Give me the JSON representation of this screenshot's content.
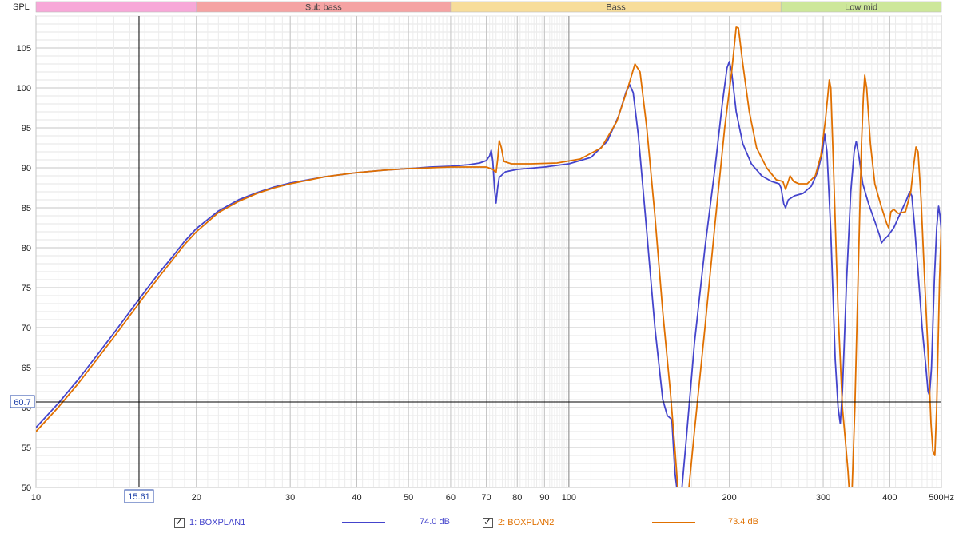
{
  "chart_data": {
    "type": "line",
    "y_axis_label": "SPL",
    "x_unit": "Hz",
    "xscale": "log",
    "xlim": [
      10,
      500
    ],
    "ylim": [
      50,
      109
    ],
    "y_ticks": [
      50,
      55,
      60,
      65,
      70,
      75,
      80,
      85,
      90,
      95,
      100,
      105
    ],
    "y_tick_labels": [
      "50",
      "55",
      "60",
      "65",
      "70",
      "75",
      "80",
      "85",
      "90",
      "95",
      "100",
      "105"
    ],
    "x_ticks": [
      10,
      20,
      30,
      40,
      50,
      60,
      70,
      80,
      90,
      100,
      200,
      300,
      400,
      500
    ],
    "x_tick_labels": [
      "10",
      "20",
      "30",
      "40",
      "50",
      "60",
      "70",
      "80",
      "90",
      "100",
      "200",
      "300",
      "400",
      "500Hz"
    ],
    "bands": [
      {
        "label": "",
        "from": 10,
        "to": 20,
        "color": "#f7a8d8"
      },
      {
        "label": "Sub bass",
        "from": 20,
        "to": 60,
        "color": "#f5a3a3"
      },
      {
        "label": "Bass",
        "from": 60,
        "to": 250,
        "color": "#f7dd9a"
      },
      {
        "label": "Low mid",
        "from": 250,
        "to": 500,
        "color": "#cde79a"
      }
    ],
    "cursor": {
      "x": 15.61,
      "y": 60.7,
      "x_label": "15.61",
      "y_label": "60.7"
    },
    "series": [
      {
        "name": "1: BOXPLAN1",
        "color": "#4444cc",
        "readout": "74.0 dB",
        "points": [
          [
            10,
            57.5
          ],
          [
            11,
            60.5
          ],
          [
            12,
            63.5
          ],
          [
            13,
            66.5
          ],
          [
            14,
            69.3
          ],
          [
            15,
            72.0
          ],
          [
            16,
            74.5
          ],
          [
            17,
            76.8
          ],
          [
            18,
            78.8
          ],
          [
            19,
            80.8
          ],
          [
            20,
            82.4
          ],
          [
            22,
            84.6
          ],
          [
            24,
            86.0
          ],
          [
            26,
            86.9
          ],
          [
            28,
            87.6
          ],
          [
            30,
            88.1
          ],
          [
            35,
            88.9
          ],
          [
            40,
            89.4
          ],
          [
            45,
            89.7
          ],
          [
            50,
            89.9
          ],
          [
            55,
            90.1
          ],
          [
            60,
            90.2
          ],
          [
            65,
            90.4
          ],
          [
            68,
            90.6
          ],
          [
            70,
            90.9
          ],
          [
            71,
            91.5
          ],
          [
            71.5,
            92.2
          ],
          [
            72,
            90.8
          ],
          [
            72.5,
            87.5
          ],
          [
            73,
            85.6
          ],
          [
            73.5,
            87.5
          ],
          [
            74,
            88.8
          ],
          [
            76,
            89.5
          ],
          [
            80,
            89.8
          ],
          [
            90,
            90.1
          ],
          [
            100,
            90.5
          ],
          [
            110,
            91.3
          ],
          [
            118,
            93.3
          ],
          [
            124,
            96.5
          ],
          [
            128,
            99.5
          ],
          [
            130,
            100.4
          ],
          [
            132,
            99.4
          ],
          [
            135,
            94.0
          ],
          [
            140,
            82.0
          ],
          [
            145,
            70.0
          ],
          [
            150,
            61.0
          ],
          [
            153,
            59.0
          ],
          [
            156,
            58.5
          ],
          [
            158,
            52.0
          ],
          [
            160,
            49.0
          ],
          [
            163,
            50.0
          ],
          [
            166,
            56.0
          ],
          [
            172,
            68.0
          ],
          [
            180,
            80.0
          ],
          [
            188,
            90.0
          ],
          [
            194,
            98.0
          ],
          [
            198,
            102.5
          ],
          [
            200,
            103.3
          ],
          [
            202,
            102.0
          ],
          [
            206,
            97.0
          ],
          [
            212,
            93.0
          ],
          [
            220,
            90.5
          ],
          [
            230,
            89.0
          ],
          [
            240,
            88.3
          ],
          [
            248,
            88.0
          ],
          [
            250,
            87.5
          ],
          [
            253,
            85.5
          ],
          [
            255,
            85.0
          ],
          [
            258,
            86.0
          ],
          [
            265,
            86.5
          ],
          [
            275,
            86.8
          ],
          [
            285,
            87.7
          ],
          [
            293,
            89.5
          ],
          [
            299,
            92.0
          ],
          [
            302,
            94.2
          ],
          [
            305,
            92.0
          ],
          [
            310,
            82.0
          ],
          [
            316,
            66.0
          ],
          [
            320,
            60.0
          ],
          [
            323,
            58.0
          ],
          [
            326,
            62.0
          ],
          [
            332,
            76.0
          ],
          [
            338,
            87.0
          ],
          [
            343,
            92.0
          ],
          [
            346,
            93.3
          ],
          [
            350,
            91.5
          ],
          [
            356,
            88.0
          ],
          [
            365,
            85.5
          ],
          [
            375,
            83.3
          ],
          [
            383,
            81.5
          ],
          [
            386,
            80.6
          ],
          [
            390,
            81.0
          ],
          [
            397,
            81.5
          ],
          [
            407,
            82.5
          ],
          [
            420,
            84.5
          ],
          [
            430,
            86.0
          ],
          [
            436,
            87.0
          ],
          [
            440,
            86.5
          ],
          [
            445,
            83.0
          ],
          [
            452,
            77.0
          ],
          [
            460,
            70.0
          ],
          [
            467,
            65.5
          ],
          [
            472,
            62.0
          ],
          [
            475,
            61.5
          ],
          [
            479,
            65.0
          ],
          [
            485,
            76.0
          ],
          [
            490,
            82.5
          ],
          [
            494,
            85.2
          ],
          [
            497,
            84.0
          ],
          [
            500,
            82.0
          ],
          [
            506,
            80.0
          ],
          [
            512,
            79.6
          ]
        ]
      },
      {
        "name": "2: BOXPLAN2",
        "color": "#e07000",
        "readout": "73.4 dB",
        "points": [
          [
            10,
            57.0
          ],
          [
            11,
            60.0
          ],
          [
            12,
            63.0
          ],
          [
            13,
            66.0
          ],
          [
            14,
            68.8
          ],
          [
            15,
            71.5
          ],
          [
            16,
            74.0
          ],
          [
            17,
            76.3
          ],
          [
            18,
            78.4
          ],
          [
            19,
            80.4
          ],
          [
            20,
            82.0
          ],
          [
            22,
            84.4
          ],
          [
            24,
            85.8
          ],
          [
            26,
            86.8
          ],
          [
            28,
            87.5
          ],
          [
            30,
            88.0
          ],
          [
            35,
            88.9
          ],
          [
            40,
            89.4
          ],
          [
            45,
            89.7
          ],
          [
            50,
            89.9
          ],
          [
            55,
            90.0
          ],
          [
            60,
            90.1
          ],
          [
            65,
            90.1
          ],
          [
            70,
            90.1
          ],
          [
            72,
            89.8
          ],
          [
            73,
            89.4
          ],
          [
            73.5,
            91.0
          ],
          [
            74,
            93.4
          ],
          [
            74.7,
            92.5
          ],
          [
            75.5,
            90.8
          ],
          [
            78,
            90.5
          ],
          [
            85,
            90.5
          ],
          [
            95,
            90.6
          ],
          [
            105,
            91.1
          ],
          [
            115,
            92.5
          ],
          [
            123,
            95.8
          ],
          [
            129,
            100.0
          ],
          [
            133,
            103.0
          ],
          [
            136,
            102.0
          ],
          [
            140,
            95.0
          ],
          [
            145,
            84.0
          ],
          [
            150,
            72.0
          ],
          [
            155,
            62.0
          ],
          [
            158,
            55.0
          ],
          [
            160,
            50.0
          ],
          [
            163,
            48.0
          ],
          [
            166,
            48.0
          ],
          [
            168,
            50.0
          ],
          [
            172,
            57.0
          ],
          [
            180,
            70.0
          ],
          [
            188,
            83.0
          ],
          [
            196,
            95.0
          ],
          [
            202,
            102.0
          ],
          [
            206,
            107.6
          ],
          [
            208,
            107.5
          ],
          [
            212,
            103.0
          ],
          [
            218,
            97.0
          ],
          [
            225,
            92.5
          ],
          [
            235,
            90.0
          ],
          [
            245,
            88.5
          ],
          [
            252,
            88.3
          ],
          [
            255,
            87.3
          ],
          [
            258,
            88.3
          ],
          [
            260,
            89.0
          ],
          [
            264,
            88.3
          ],
          [
            270,
            88.0
          ],
          [
            280,
            88.0
          ],
          [
            290,
            89.0
          ],
          [
            297,
            91.5
          ],
          [
            303,
            96.0
          ],
          [
            308,
            101.0
          ],
          [
            310,
            100.0
          ],
          [
            314,
            89.0
          ],
          [
            320,
            72.0
          ],
          [
            326,
            60.0
          ],
          [
            330,
            56.0
          ],
          [
            334,
            52.0
          ],
          [
            337,
            48.0
          ],
          [
            340,
            50.0
          ],
          [
            344,
            60.0
          ],
          [
            350,
            80.0
          ],
          [
            354,
            93.0
          ],
          [
            357,
            99.0
          ],
          [
            359,
            101.6
          ],
          [
            362,
            100.0
          ],
          [
            368,
            93.0
          ],
          [
            375,
            88.0
          ],
          [
            385,
            85.3
          ],
          [
            395,
            83.0
          ],
          [
            398,
            82.5
          ],
          [
            402,
            84.5
          ],
          [
            407,
            84.8
          ],
          [
            415,
            84.3
          ],
          [
            428,
            84.5
          ],
          [
            438,
            87.0
          ],
          [
            444,
            90.5
          ],
          [
            448,
            92.6
          ],
          [
            452,
            92.0
          ],
          [
            458,
            86.0
          ],
          [
            465,
            76.0
          ],
          [
            472,
            67.0
          ],
          [
            478,
            58.0
          ],
          [
            482,
            54.5
          ],
          [
            486,
            54.0
          ],
          [
            490,
            60.0
          ],
          [
            496,
            76.0
          ],
          [
            502,
            87.0
          ],
          [
            506,
            91.0
          ],
          [
            509,
            90.0
          ],
          [
            512,
            86.0
          ]
        ]
      }
    ]
  },
  "legend": {
    "s1_label": "1: BOXPLAN1",
    "s1_value": "74.0 dB",
    "s2_label": "2: BOXPLAN2",
    "s2_value": "73.4 dB",
    "s1_checked": true,
    "s2_checked": true
  }
}
